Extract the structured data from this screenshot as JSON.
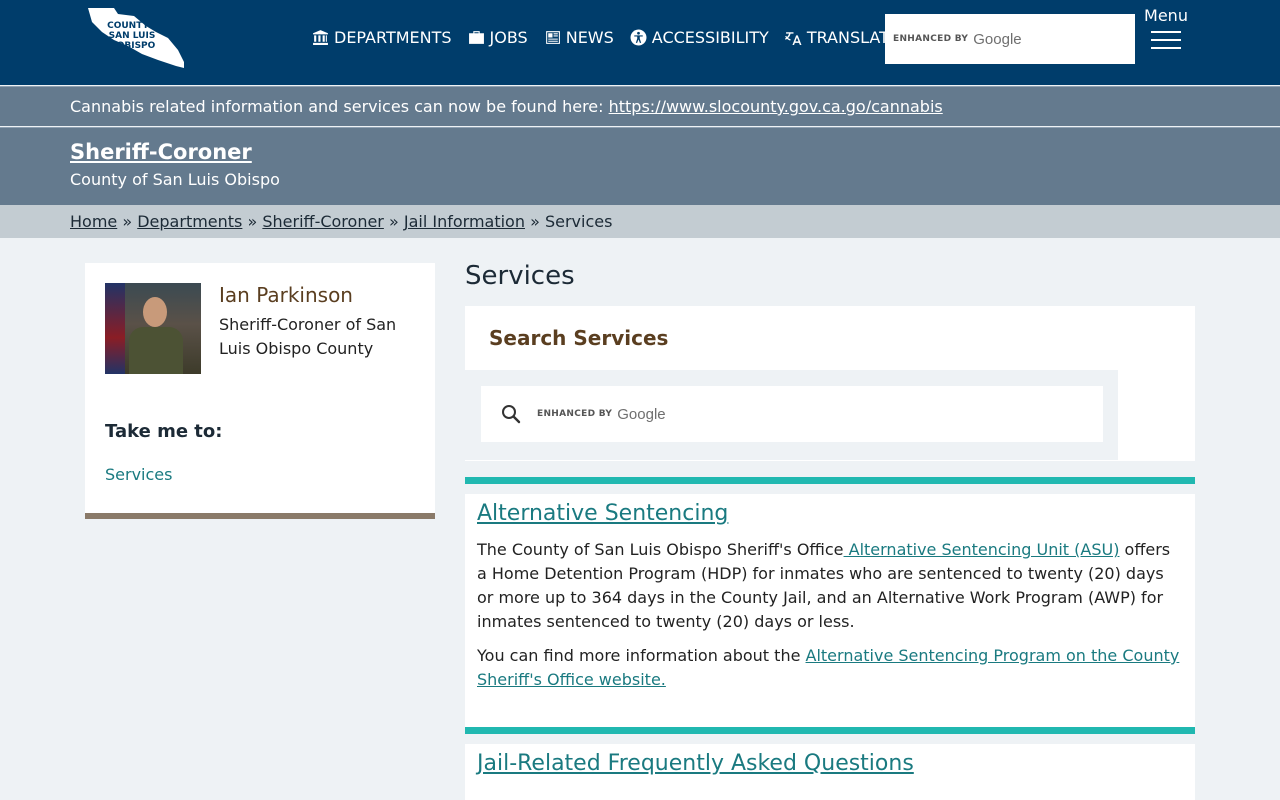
{
  "header": {
    "logo_text": [
      "COUNTY",
      "SAN LUIS",
      "OBISPO"
    ],
    "nav": [
      {
        "label": "DEPARTMENTS",
        "icon": "building-icon"
      },
      {
        "label": "JOBS",
        "icon": "briefcase-icon"
      },
      {
        "label": "NEWS",
        "icon": "newspaper-icon"
      },
      {
        "label": "ACCESSIBILITY",
        "icon": "accessibility-icon"
      },
      {
        "label": "TRANSLATE",
        "icon": "translate-icon"
      }
    ],
    "search": {
      "enhanced_by": "ENHANCED BY",
      "brand": "Google"
    },
    "menu_label": "Menu"
  },
  "alert": {
    "text": "Cannabis related information and services can now be found here: ",
    "link": "https://www.slocounty.gov.ca.go/cannabis"
  },
  "department": {
    "title": "Sheriff-Coroner",
    "subtitle": "County of San Luis Obispo"
  },
  "breadcrumb": {
    "items": [
      "Home",
      "Departments",
      "Sheriff-Coroner",
      "Jail Information"
    ],
    "separator": "»",
    "current": "Services"
  },
  "sidebar": {
    "name": "Ian Parkinson",
    "title": "Sheriff-Coroner of San Luis Obispo County",
    "take_me_to": "Take me to:",
    "links": [
      "Services"
    ]
  },
  "main": {
    "title": "Services",
    "search_heading": "Search Services",
    "search": {
      "enhanced_by": "ENHANCED BY",
      "brand": "Google"
    },
    "cards": [
      {
        "title": "Alternative Sentencing",
        "p1_before": "The County of San Luis Obispo Sheriff's Office",
        "p1_link": " Alternative Sentencing Unit (ASU)",
        "p1_after": " offers a Home Detention Program (HDP) for inmates who are sentenced to twenty (20) days or more up to 364 days in the County Jail, and an Alternative Work Program (AWP) for inmates sentenced to twenty (20) days or less.",
        "p2_before": "You can find more information about the ",
        "p2_link": "Alternative Sentencing Program on the County Sheriff's Office website."
      },
      {
        "title": "Jail-Related Frequently Asked Questions"
      }
    ]
  },
  "colors": {
    "header_bg": "#003d6b",
    "alert_bg": "#647a8e",
    "crumb_bg": "#c3ccd2",
    "accent_teal": "#20b8b0",
    "link": "#1a7a80",
    "sidebar_border": "#8a7a69"
  }
}
